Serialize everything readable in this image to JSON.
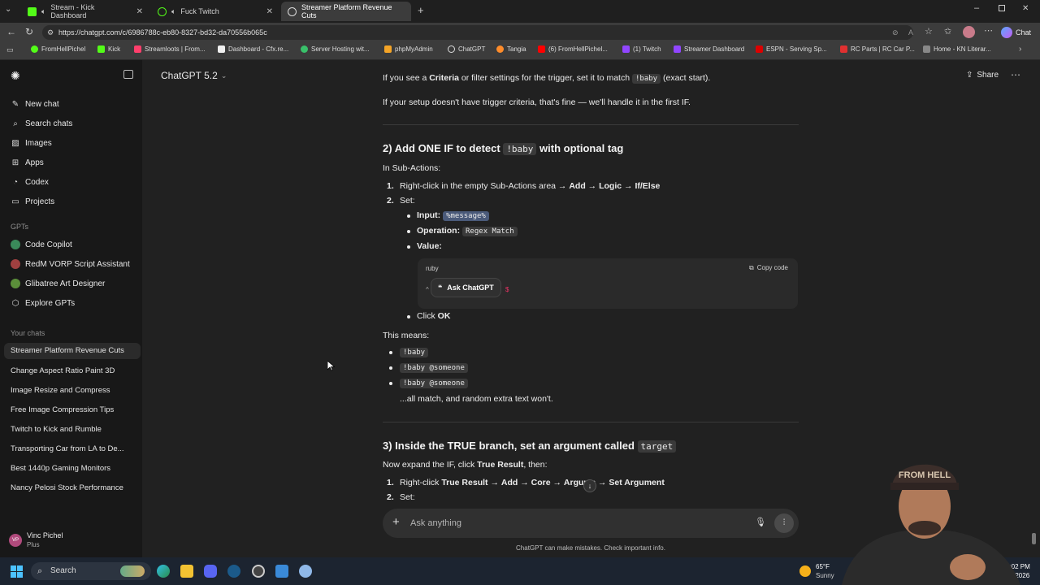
{
  "browser": {
    "tabs": [
      {
        "title": "Stream - Kick Dashboard",
        "color": "#53fc18"
      },
      {
        "title": "Fuck Twitch",
        "color": "#53fc18"
      },
      {
        "title": "Streamer Platform Revenue Cuts",
        "color": "#ffffff"
      }
    ],
    "url": "https://chatgpt.com/c/6986788c-eb80-8327-bd32-da70556b065c",
    "chat_button": "Chat",
    "bookmarks": [
      "FromHellPichel",
      "Kick",
      "Streamloots | From...",
      "Dashboard - Cfx.re...",
      "Server Hosting wit...",
      "phpMyAdmin",
      "ChatGPT",
      "Tangia",
      "(6) FromHellPichel...",
      "(1) Twitch",
      "Streamer Dashboard",
      "ESPN - Serving Sp...",
      "RC Parts | RC Car P...",
      "Home - KN Literar..."
    ]
  },
  "sidebar": {
    "nav": [
      "New chat",
      "Search chats",
      "Images",
      "Apps",
      "Codex",
      "Projects"
    ],
    "gpts_heading": "GPTs",
    "gpts": [
      "Code Copilot",
      "RedM VORP Script Assistant",
      "Glibatree Art Designer",
      "Explore GPTs"
    ],
    "chats_heading": "Your chats",
    "chats": [
      "Streamer Platform Revenue Cuts",
      "Change Aspect Ratio Paint 3D",
      "Image Resize and Compress",
      "Free Image Compression Tips",
      "Twitch to Kick and Rumble",
      "Transporting Car from LA to De...",
      "Best 1440p Gaming Monitors",
      "Nancy Pelosi Stock Performance"
    ],
    "user": {
      "name": "Vinc Pichel",
      "plan": "Plus",
      "initials": "VP"
    }
  },
  "header": {
    "model": "ChatGPT 5.2",
    "share": "Share"
  },
  "content": {
    "p1_a": "If you see a ",
    "p1_b": "Criteria",
    "p1_c": " or filter settings for the trigger, set it to match ",
    "p1_code": "!baby",
    "p1_d": " (exact start).",
    "p2": "If your setup doesn't have trigger criteria, that's fine — we'll handle it in the first IF.",
    "h2_a": "2) Add ONE IF to detect ",
    "h2_code": "!baby",
    "h2_b": " with optional tag",
    "in_sub": "In Sub-Actions:",
    "step1_a": "Right-click in the empty Sub-Actions area → ",
    "step1_b": "Add",
    "step1_c": " → ",
    "step1_d": "Logic",
    "step1_e": " → ",
    "step1_f": "If/Else",
    "step2": "Set:",
    "input_label": "Input:",
    "input_code": "%message%",
    "op_label": "Operation:",
    "op_code": "Regex Match",
    "value_label": "Value:",
    "code_lang": "ruby",
    "copy_code": "Copy code",
    "ask_chatgpt": "Ask ChatGPT",
    "click": "Click ",
    "ok": "OK",
    "means": "This means:",
    "ex1": "!baby",
    "ex2": "!baby @someone",
    "ex3": "!baby @someone",
    "all_match": "...all match, and random extra text won't.",
    "h3_a": "3) Inside the TRUE branch, set an argument called ",
    "h3_code": "target",
    "expand_a": "Now expand the IF, click ",
    "expand_b": "True Result",
    "expand_c": ", then:",
    "s31_a": "Right-click ",
    "s31_b": "True Result",
    "s31_c": " → ",
    "s31_d": "Add",
    "s31_e": " → ",
    "s31_f": "Core",
    "s31_g": " → ",
    "s31_h": "Argum",
    "s31_i": "s → ",
    "s31_j": "Set Argument",
    "s32": "Set:"
  },
  "composer": {
    "placeholder": "Ask anything",
    "disclaimer": "ChatGPT can make mistakes. Check important info."
  },
  "taskbar": {
    "search": "Search",
    "weather_temp": "65°F",
    "weather_desc": "Sunny",
    "time": "2:02 PM",
    "date": "2/8/2026"
  },
  "webcam": {
    "hat_text": "FROM HELL"
  }
}
